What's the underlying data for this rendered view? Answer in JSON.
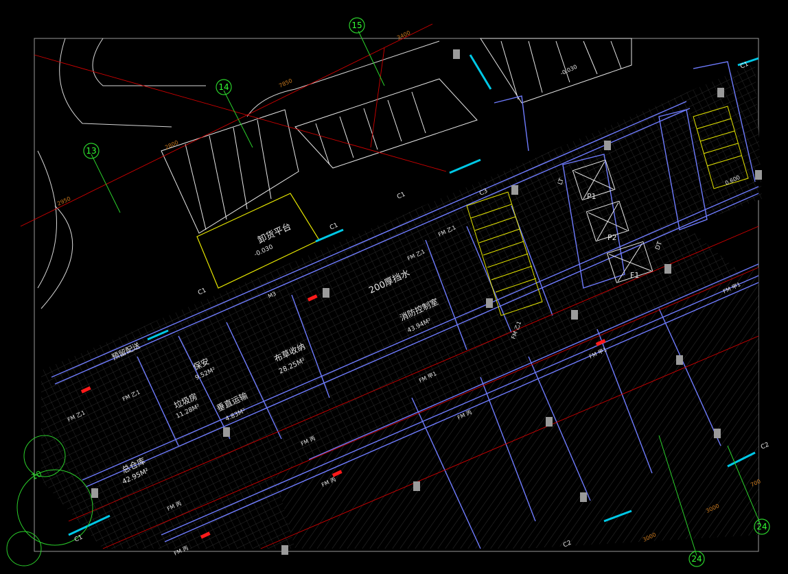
{
  "colors": {
    "background": "#000000",
    "wall": "#6f7cff",
    "hatch": "#3a3a3a",
    "white_line": "#e8e8e8",
    "red_line": "#d40000",
    "green_axis": "#2bd12b",
    "yellow": "#e6e600",
    "cyan": "#00c8e6",
    "orange_dim": "#c8781e"
  },
  "axes": [
    {
      "id": "13",
      "label": "13"
    },
    {
      "id": "14",
      "label": "14"
    },
    {
      "id": "15",
      "label": "15"
    },
    {
      "id": "24",
      "label": "24"
    },
    {
      "id": "24b",
      "label": "24"
    }
  ],
  "rooms": {
    "loading_platform": {
      "name": "卸货平台",
      "elev": "-0.030"
    },
    "partition_note": {
      "text": "200厚挡水"
    },
    "fire_control": {
      "name": "消防控制室",
      "area": "43.94M²"
    },
    "storage": {
      "name": "布草收纳",
      "area": "28.25M²"
    },
    "security": {
      "name": "保安",
      "area": "9.52M²"
    },
    "garbage": {
      "name": "垃圾房",
      "area": "11.28M²"
    },
    "hazardous": {
      "name": "垂直运输",
      "area": "4.83M²"
    },
    "general_store": {
      "name": "总仓库",
      "area": "42.95M²"
    },
    "door_note": {
      "text": "预留配送"
    }
  },
  "doors": {
    "fm_z1": "FM 乙1",
    "fm_a": "FM 甲1",
    "fm_bing": "FM 丙",
    "m3": "M3"
  },
  "elevators": [
    "P1",
    "P2",
    "F1"
  ],
  "dims": {
    "d1": "2950",
    "d2": "7850",
    "d3": "3400",
    "d4": "2800",
    "d5": "3000",
    "d6": "700",
    "d7": "0.600",
    "d8": "-0.030"
  },
  "misc": {
    "c1": "C1",
    "c2": "C2",
    "c3": "C3",
    "lt": "LT",
    "dt": "DT",
    "unit_10": "10"
  }
}
